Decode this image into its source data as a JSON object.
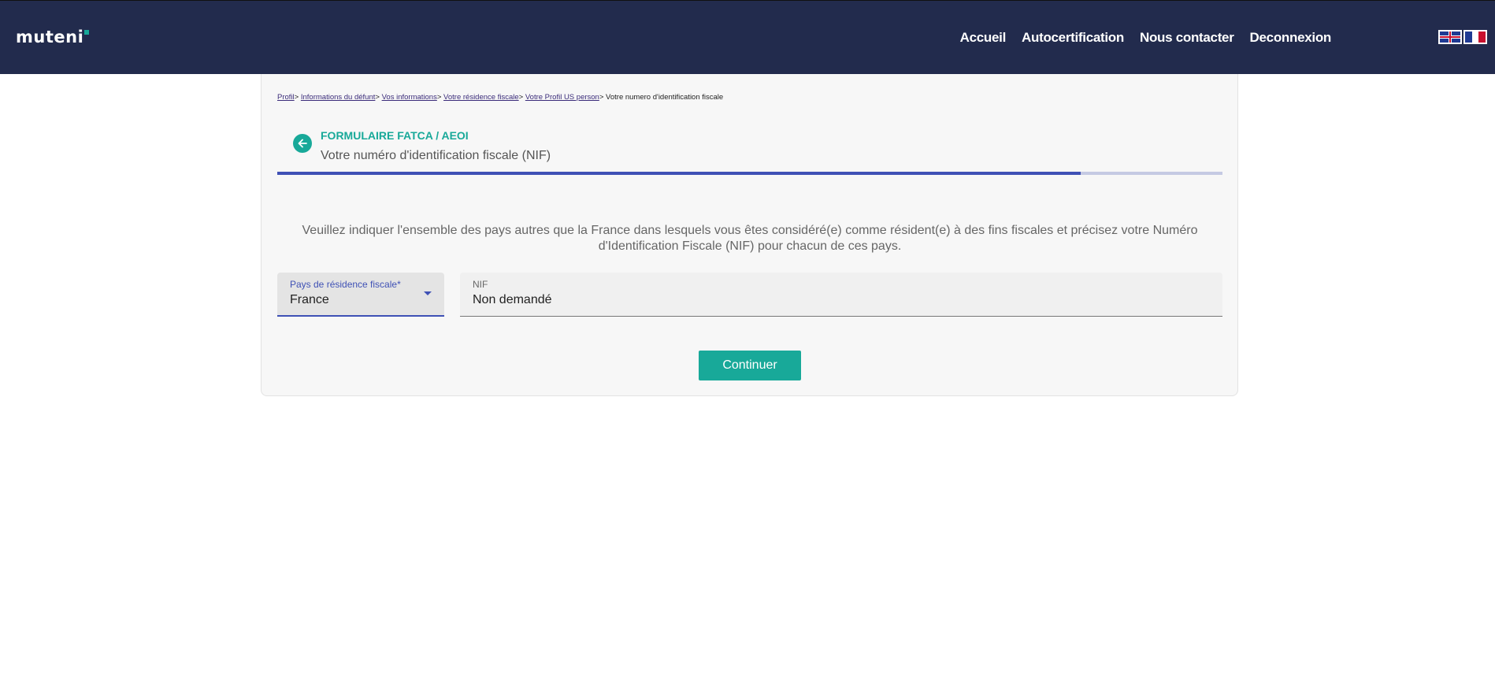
{
  "header": {
    "logo": "muteni",
    "nav": [
      "Accueil",
      "Autocertification",
      "Nous contacter",
      "Deconnexion"
    ],
    "languages": [
      "English",
      "Français"
    ]
  },
  "breadcrumb": {
    "items": [
      "Profil",
      "Informations du défunt",
      "Vos informations",
      "Votre résidence fiscale",
      "Votre Profil US person"
    ],
    "current": "Votre numero d'identification fiscale",
    "separator": ">"
  },
  "form": {
    "title": "FORMULAIRE FATCA / AEOI",
    "subtitle": "Votre numéro d'identification fiscale (NIF)",
    "progress": 0.85,
    "instructions": "Veuillez indiquer l'ensemble des pays autres que la France dans lesquels vous êtes considéré(e) comme résident(e) à des fins fiscales et précisez votre Numéro d'Identification Fiscale (NIF) pour chacun de ces pays.",
    "country_label": "Pays de résidence fiscale*",
    "country_value": "France",
    "nif_label": "NIF",
    "nif_value": "Non demandé",
    "continue_label": "Continuer"
  },
  "colors": {
    "header_bg": "#222b4d",
    "accent": "#18a999",
    "primary": "#3f51b5"
  },
  "icons": {
    "back": "arrow-left-icon",
    "dropdown": "caret-down-icon"
  }
}
